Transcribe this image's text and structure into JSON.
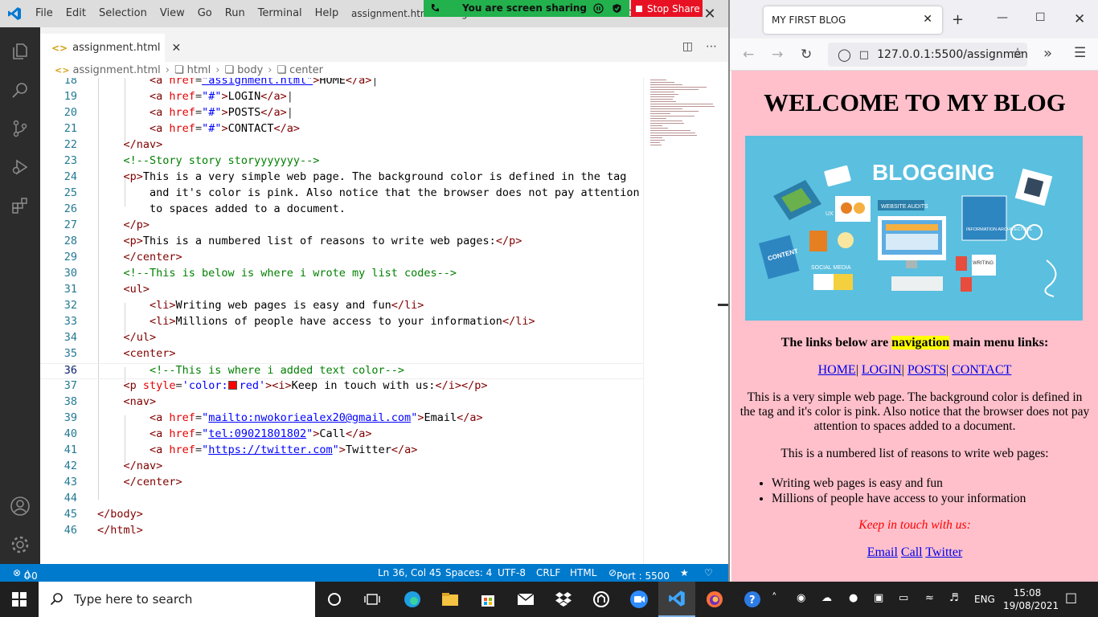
{
  "vscode": {
    "menu": [
      "File",
      "Edit",
      "Selection",
      "View",
      "Go",
      "Run",
      "Terminal",
      "Help"
    ],
    "window_title": "assignment.html - Assignment correction - Visual Studio Code",
    "tab_label": "assignment.html",
    "breadcrumb": [
      "assignment.html",
      "html",
      "body",
      "center"
    ],
    "lines": [
      {
        "n": "18"
      },
      {
        "n": "19"
      },
      {
        "n": "20"
      },
      {
        "n": "21"
      },
      {
        "n": "22"
      },
      {
        "n": "23"
      },
      {
        "n": "24"
      },
      {
        "n": "25"
      },
      {
        "n": "26"
      },
      {
        "n": "27"
      },
      {
        "n": "28"
      },
      {
        "n": "29"
      },
      {
        "n": "30"
      },
      {
        "n": "31"
      },
      {
        "n": "32"
      },
      {
        "n": "33"
      },
      {
        "n": "34"
      },
      {
        "n": "35"
      },
      {
        "n": "36"
      },
      {
        "n": "37"
      },
      {
        "n": "38"
      },
      {
        "n": "39"
      },
      {
        "n": "40"
      },
      {
        "n": "41"
      },
      {
        "n": "42"
      },
      {
        "n": "43"
      },
      {
        "n": "44"
      },
      {
        "n": "45"
      },
      {
        "n": "46"
      }
    ],
    "code": {
      "l18_href": "\"assignment.html\"",
      "l18_text": "HOME",
      "l19_text": "LOGIN",
      "l20_text": "POSTS",
      "l21_text": "CONTACT",
      "hash": "\"#\"",
      "l23": "<!--Story story storyyyyyyy-->",
      "l24": "This is a very simple web page. The background color is defined in the tag",
      "l25": "and it's color is pink. Also notice that the browser does not pay attention",
      "l26": "to spaces added to a document.",
      "l28": "This is a numbered list of reasons to write web pages:",
      "l30": "<!--This is below is where i wrote my list codes-->",
      "l32": "Writing web pages is easy and fun",
      "l33": "Millions of people have access to your information",
      "l36": "<!--This is where i added text color-->",
      "l37_style_a": "'color:",
      "l37_style_b": "red'",
      "l37_text": "Keep in touch with us:",
      "l39_href": "mailto:nwokoriealex20@gmail.com",
      "l39_text": "Email",
      "l40_href": "tel:09021801802",
      "l40_text": "Call",
      "l41_href": "https://twitter.com",
      "l41_text": "Twitter"
    },
    "status": {
      "errors": "0",
      "warnings": "0",
      "position": "Ln 36, Col 45",
      "spaces": "Spaces: 4",
      "encoding": "UTF-8",
      "eol": "CRLF",
      "language": "HTML",
      "port": "Port : 5500"
    },
    "screen_share": {
      "text": "You are screen sharing",
      "stop": "Stop Share"
    }
  },
  "firefox": {
    "tab_title": "MY FIRST BLOG",
    "url": "127.0.0.1:5500/assignmen"
  },
  "blog": {
    "heading": "WELCOME TO MY BLOG",
    "hero": {
      "title": "BLOGGING",
      "labels": [
        "WEBSITE AUDITS",
        "UX",
        "CONTENT",
        "SOCIAL MEDIA",
        "INFORMATION ARCHITECTURE",
        "WRITING"
      ]
    },
    "nav_note_before": "The links below are ",
    "nav_note_highlight": "navigation",
    "nav_note_after": " main menu links:",
    "nav_links": [
      "HOME",
      "LOGIN",
      "POSTS",
      "CONTACT"
    ],
    "intro": "This is a very simple web page. The background color is defined in the tag and it's color is pink. Also notice that the browser does not pay attention to spaces added to a document.",
    "reasons_heading": "This is a numbered list of reasons to write web pages:",
    "list": [
      "Writing web pages is easy and fun",
      "Millions of people have access to your information"
    ],
    "keep_in_touch": "Keep in touch with us:",
    "contact_links": [
      "Email",
      "Call",
      "Twitter"
    ]
  },
  "taskbar": {
    "search_placeholder": "Type here to search",
    "language": "ENG",
    "time": "15:08",
    "date": "19/08/2021"
  }
}
